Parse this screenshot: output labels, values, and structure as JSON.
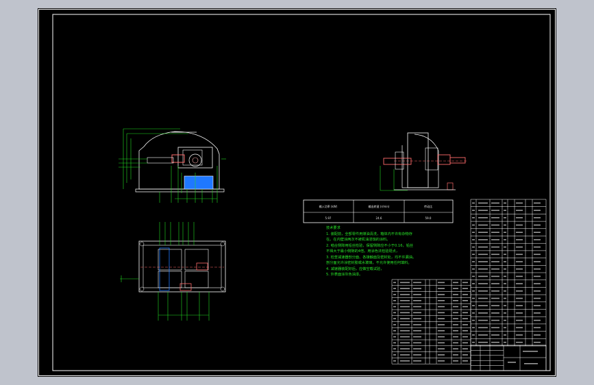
{
  "viewport": {
    "background": "#bfc3cc",
    "drawing_background": "#000000"
  },
  "colors": {
    "frame": "#ffffff",
    "drawing_lines": "#ffffff",
    "dimension_lines": "#22dd22",
    "hatch_fill": "#1f78ff",
    "accent": "#ff4444"
  },
  "parameter_table": {
    "headers": [
      "输入功率 (kW)",
      "输出转速 (r/min)",
      "传动比"
    ],
    "values": [
      "5.97",
      "24.6",
      "59.0"
    ]
  },
  "technical_requirements": {
    "title": "技术要求",
    "lines": [
      "1. 装配前，全部零件用煤油清洗，箱体内不许有杂物存",
      "在。在内壁涂两次不被机油浸蚀的涂料。",
      "2. 啮合侧隙用铅丝检验，保留侧隙应不小于0.16，铅丝",
      "不得大于最小侧隙的4倍。用涂色法检验斑点，",
      "3. 检查减速器剖分面、各接触面及密封处，均不许漏油。",
      "剖分面允许涂密封胶或水玻璃，不允许使用任何填料。",
      "4. 减速器装配好后，应做空载试验，",
      "5. 外表面涂灰色油漆。"
    ]
  },
  "parts_list_rows": 20,
  "title_block_rows": 5
}
